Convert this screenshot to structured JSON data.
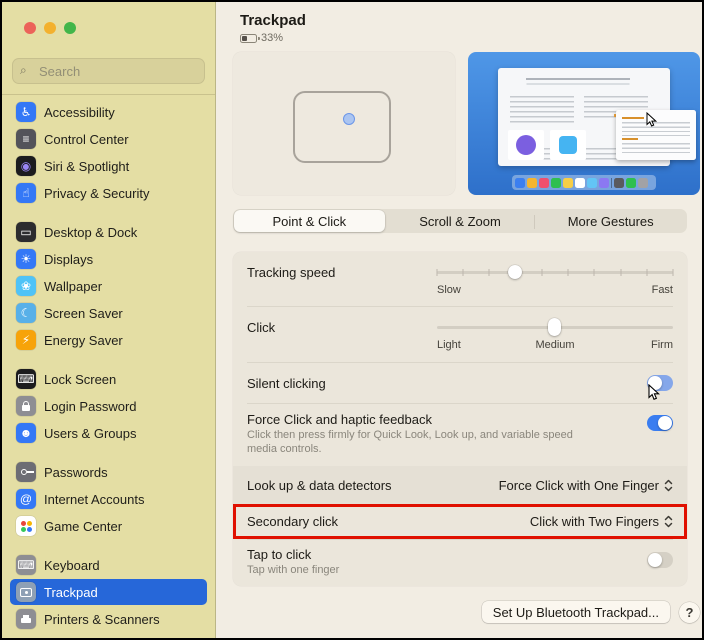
{
  "window": {
    "traffic_lights": [
      "#ec6359",
      "#f3b12e",
      "#43b64a"
    ]
  },
  "sidebar": {
    "search": {
      "placeholder": "Search",
      "icon": "search-icon"
    },
    "groups": [
      {
        "items": [
          {
            "label": "Accessibility",
            "bg": "#3478f6",
            "glyph": "♿"
          },
          {
            "label": "Control Center",
            "bg": "#53535a",
            "glyph": "≡"
          },
          {
            "label": "Siri & Spotlight",
            "bg": "#1c1c1e",
            "glyph": "◉",
            "glyph_color": "#9a86f5"
          },
          {
            "label": "Privacy & Security",
            "bg": "#3478f6",
            "glyph": "☝"
          }
        ]
      },
      {
        "items": [
          {
            "label": "Desktop & Dock",
            "bg": "#2c2c2e",
            "glyph": "▭"
          },
          {
            "label": "Displays",
            "bg": "#3478f6",
            "glyph": "☀"
          },
          {
            "label": "Wallpaper",
            "bg": "#4fc3f7",
            "glyph": "❀"
          },
          {
            "label": "Screen Saver",
            "bg": "#58b0e8",
            "glyph": "☾"
          },
          {
            "label": "Energy Saver",
            "bg": "#f7a309",
            "glyph": "⚡"
          }
        ]
      },
      {
        "items": [
          {
            "label": "Lock Screen",
            "bg": "#1c1c1e",
            "glyph": "⌨"
          },
          {
            "label": "Login Password",
            "bg": "#8e8e93",
            "glyph": "css-lock"
          },
          {
            "label": "Users & Groups",
            "bg": "#3478f6",
            "glyph": "☻"
          }
        ]
      },
      {
        "items": [
          {
            "label": "Passwords",
            "bg": "#6d6d74",
            "glyph": "css-key"
          },
          {
            "label": "Internet Accounts",
            "bg": "#3478f6",
            "glyph": "@"
          },
          {
            "label": "Game Center",
            "bg": "#ffffff",
            "glyph": "css-bubbles"
          }
        ]
      },
      {
        "items": [
          {
            "label": "Keyboard",
            "bg": "#8e8e93",
            "glyph": "⌨"
          },
          {
            "label": "Trackpad",
            "bg": "#8ea0b5",
            "glyph": "css-trackpad",
            "selected": true
          },
          {
            "label": "Printers & Scanners",
            "bg": "#8e8e93",
            "glyph": "css-printer"
          }
        ]
      }
    ]
  },
  "header": {
    "title": "Trackpad",
    "battery_percent": "33%"
  },
  "preview": {
    "dock_colors": [
      "#3b7ff0",
      "#f5b52e",
      "#ef4f6e",
      "#2fbf4f",
      "#f7ce46",
      "#ffffff",
      "#63c5f5",
      "#8b78f2",
      "divider",
      "#5a5a5e",
      "#2fbf4f",
      "#a2a2a6"
    ]
  },
  "tabs": {
    "items": [
      "Point & Click",
      "Scroll & Zoom",
      "More Gestures"
    ],
    "selected_index": 0
  },
  "settings": {
    "tracking_speed": {
      "label": "Tracking speed",
      "min_label": "Slow",
      "max_label": "Fast",
      "value_percent": 33,
      "ticks": 10
    },
    "click": {
      "label": "Click",
      "min_label": "Light",
      "mid_label": "Medium",
      "max_label": "Firm",
      "value_percent": 50
    },
    "silent_clicking": {
      "label": "Silent clicking",
      "state": "transitioning"
    },
    "force_click": {
      "label": "Force Click and haptic feedback",
      "description": "Click then press firmly for Quick Look, Look up, and variable speed media controls.",
      "state": "on"
    },
    "look_up": {
      "label": "Look up & data detectors",
      "value": "Force Click with One Finger"
    },
    "secondary_click": {
      "label": "Secondary click",
      "value": "Click with Two Fingers",
      "highlighted": true
    },
    "tap_to_click": {
      "label": "Tap to click",
      "description": "Tap with one finger",
      "state": "off"
    }
  },
  "footer": {
    "setup_button": "Set Up Bluetooth Trackpad...",
    "help_button": "?"
  },
  "colors": {
    "accent": "#3a7df0",
    "selected_row": "#2667d9",
    "annotation_red": "#e01000",
    "sidebar_bg": "#e4dea4"
  }
}
